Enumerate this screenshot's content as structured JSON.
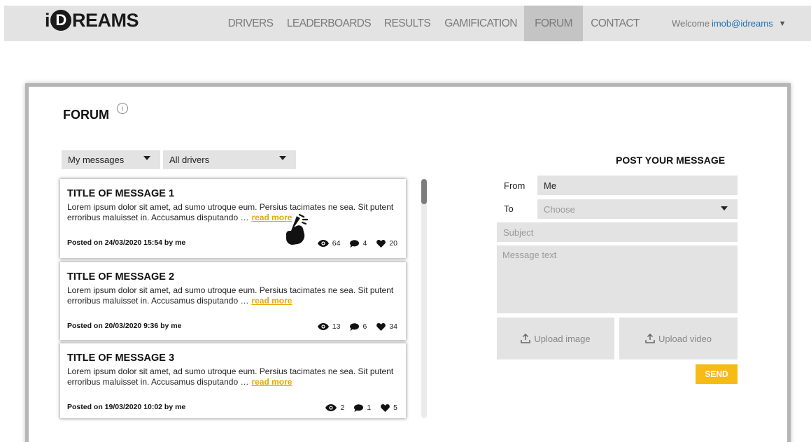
{
  "header": {
    "logo_prefix": "i",
    "logo_circle": "D",
    "logo_suffix": "REAMS",
    "nav": [
      "DRIVERS",
      "LEADERBOARDS",
      "RESULTS",
      "GAMIFICATION",
      "FORUM",
      "CONTACT"
    ],
    "active_nav": "FORUM",
    "welcome_label": "Welcome",
    "user": "imob@idreams",
    "user_caret": "▼"
  },
  "forum": {
    "title": "FORUM",
    "info_glyph": "i",
    "filter_scope": "My messages",
    "filter_drivers": "All drivers"
  },
  "messages": [
    {
      "title": "TITLE OF MESSAGE 1",
      "body": "Lorem ipsum dolor sit amet, ad sumo utroque eum. Persius tacimates ne sea. Sit putent erroribus maluisset in. Accusamus disputando …",
      "read_more": "read more",
      "posted": "Posted on 24/03/2020 15:54 by me",
      "views": "64",
      "comments": "4",
      "likes": "20"
    },
    {
      "title": "TITLE OF MESSAGE 2",
      "body": "Lorem ipsum dolor sit amet, ad sumo utroque eum. Persius tacimates ne sea. Sit putent erroribus maluisset in. Accusamus disputando …",
      "read_more": "read more",
      "posted": "Posted on 20/03/2020 9:36 by me",
      "views": "13",
      "comments": "6",
      "likes": "34"
    },
    {
      "title": "TITLE OF MESSAGE 3",
      "body": "Lorem ipsum dolor sit amet, ad sumo utroque eum. Persius tacimates ne sea. Sit putent erroribus maluisset in. Accusamus disputando …",
      "read_more": "read more",
      "posted": "Posted on 19/03/2020 10:02 by me",
      "views": "2",
      "comments": "1",
      "likes": "5"
    }
  ],
  "post": {
    "title": "POST YOUR MESSAGE",
    "from_label": "From",
    "from_value": "Me",
    "to_label": "To",
    "to_placeholder": "Choose",
    "subject_placeholder": "Subject",
    "message_placeholder": "Message text",
    "upload_image": "Upload image",
    "upload_video": "Upload video",
    "send": "SEND"
  },
  "colors": {
    "accent": "#f7bb18",
    "link": "#1f6fb5",
    "nav_active": "#c4c4c4",
    "field_bg": "#e3e3e3"
  }
}
